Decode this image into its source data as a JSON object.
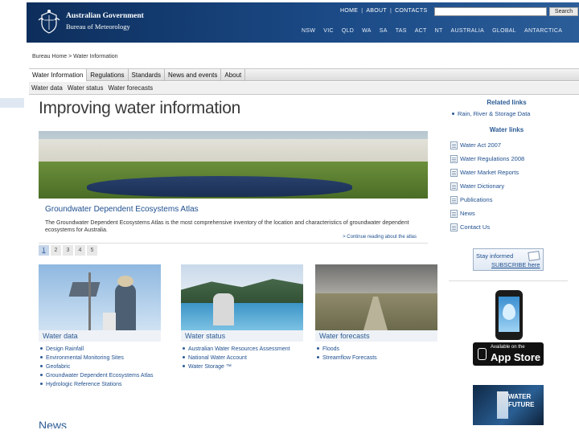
{
  "header": {
    "gov_line1": "Australian Government",
    "gov_line2": "Bureau of Meteorology",
    "top_links": [
      "HOME",
      "ABOUT",
      "CONTACTS"
    ],
    "search_placeholder": "",
    "search_button": "Search",
    "states": [
      "NSW",
      "VIC",
      "QLD",
      "WA",
      "SA",
      "TAS",
      "ACT",
      "NT",
      "AUSTRALIA",
      "GLOBAL",
      "ANTARCTICA"
    ]
  },
  "breadcrumb": "Bureau Home > Water Information",
  "main_nav": [
    "Water Information",
    "Regulations",
    "Standards",
    "News and events",
    "About"
  ],
  "sub_nav": [
    "Water data",
    "Water status",
    "Water forecasts"
  ],
  "page_title": "Improving water information",
  "hero": {
    "title": "Groundwater Dependent Ecosystems Atlas",
    "description": "The Groundwater Dependent Ecosystems Atlas is the most comprehensive inventory of the location and characteristics of groundwater dependent ecosystems for Australia.",
    "more": "> Continue reading about the atlas",
    "pages": [
      "1",
      "2",
      "3",
      "4",
      "5"
    ],
    "active_page": "1"
  },
  "sections": [
    {
      "title": "Water data",
      "links": [
        "Design Rainfall",
        "Environmental Monitoring Sites",
        "Geofabric",
        "Groundwater Dependent Ecosystems Atlas",
        "Hydrologic Reference Stations"
      ]
    },
    {
      "title": "Water status",
      "links": [
        "Australian Water Resources Assessment",
        "National Water Account",
        "Water Storage ™"
      ]
    },
    {
      "title": "Water forecasts",
      "links": [
        "Floods",
        "Streamflow Forecasts"
      ]
    }
  ],
  "news_heading": "News",
  "right_column": {
    "related_heading": "Related links",
    "related_links": [
      "Rain, River & Storage Data"
    ],
    "water_heading": "Water links",
    "water_links": [
      "Water Act 2007",
      "Water Regulations 2008",
      "Water Market Reports",
      "Water Dictionary",
      "Publications",
      "News",
      "Contact Us"
    ],
    "stay_line1": "Stay informed",
    "stay_line2": "SUBSCRIBE here",
    "appstore_small": "Available on the",
    "appstore_large": "App Store",
    "wff_text": "WATER FUTURE"
  },
  "colors": {
    "header_dark": "#0d2e5c",
    "link_blue": "#1f4f8f",
    "accent": "#2b5a94"
  }
}
